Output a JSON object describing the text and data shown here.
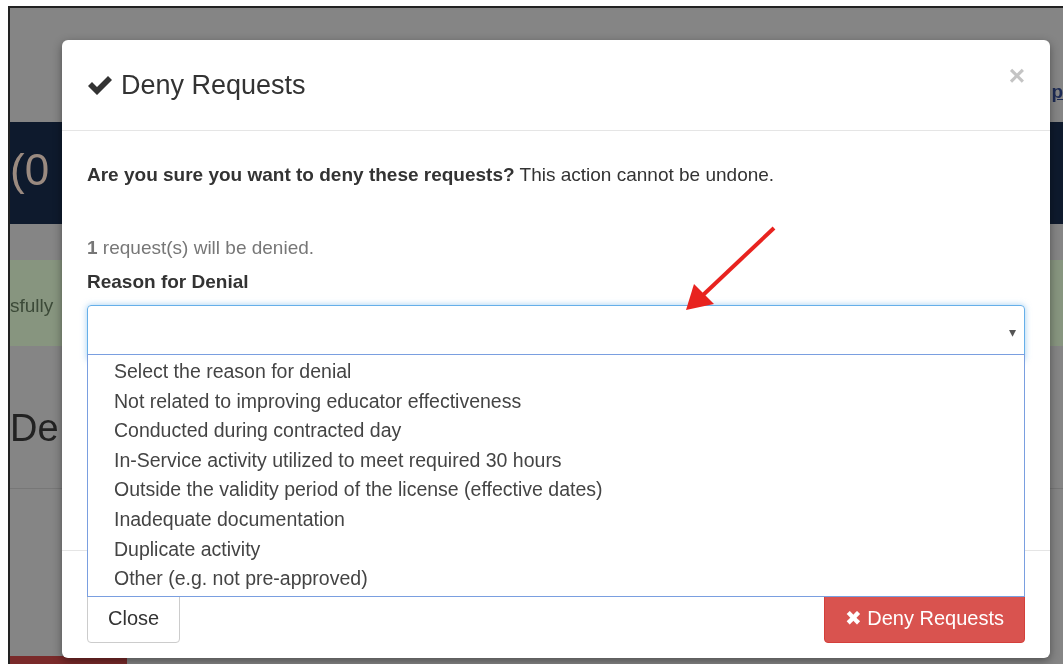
{
  "background": {
    "link_text": "p",
    "banner_text": "(0",
    "alert_text": "sfully",
    "heading_text": "De"
  },
  "modal": {
    "title": "Deny Requests",
    "close": "×",
    "question": "**Are you sure you want to deny these requests?** This action cannot be undone.",
    "count_text": "**1** request(s) will be denied.",
    "reason_label": "Reason for Denial",
    "select": {
      "expanded": true,
      "caret": "▾"
    },
    "options": [
      {
        "label": "Select the reason for denial",
        "selected": false
      },
      {
        "label": "Not related to improving educator effectiveness",
        "selected": false
      },
      {
        "label": "Conducted during contracted day",
        "selected": false
      },
      {
        "label": "In-Service activity utilized to meet required 30 hours",
        "selected": false
      },
      {
        "label": "Outside the validity period of the license (effective dates)",
        "selected": false
      },
      {
        "label": "Inadequate documentation",
        "selected": false
      },
      {
        "label": "Duplicate activity",
        "selected": false
      },
      {
        "label": "Other (e.g. not pre-approved)",
        "selected": false
      }
    ],
    "buttons": [
      {
        "kind": "default",
        "label": "Close"
      },
      {
        "kind": "danger",
        "icon": "✖",
        "label": "Deny Requests"
      }
    ]
  }
}
